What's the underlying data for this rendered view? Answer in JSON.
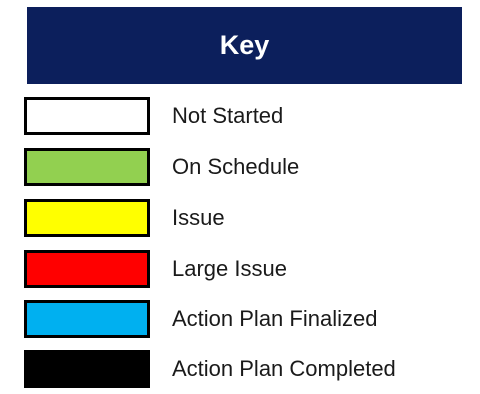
{
  "key": {
    "title": "Key",
    "header_color": "#0c1f5c"
  },
  "legend": {
    "items": [
      {
        "label": "Not Started",
        "color": "#ffffff"
      },
      {
        "label": "On Schedule",
        "color": "#92d050"
      },
      {
        "label": "Issue",
        "color": "#ffff00"
      },
      {
        "label": "Large Issue",
        "color": "#ff0000"
      },
      {
        "label": "Action Plan Finalized",
        "color": "#00b0f0"
      },
      {
        "label": "Action Plan Completed",
        "color": "#000000"
      }
    ]
  }
}
